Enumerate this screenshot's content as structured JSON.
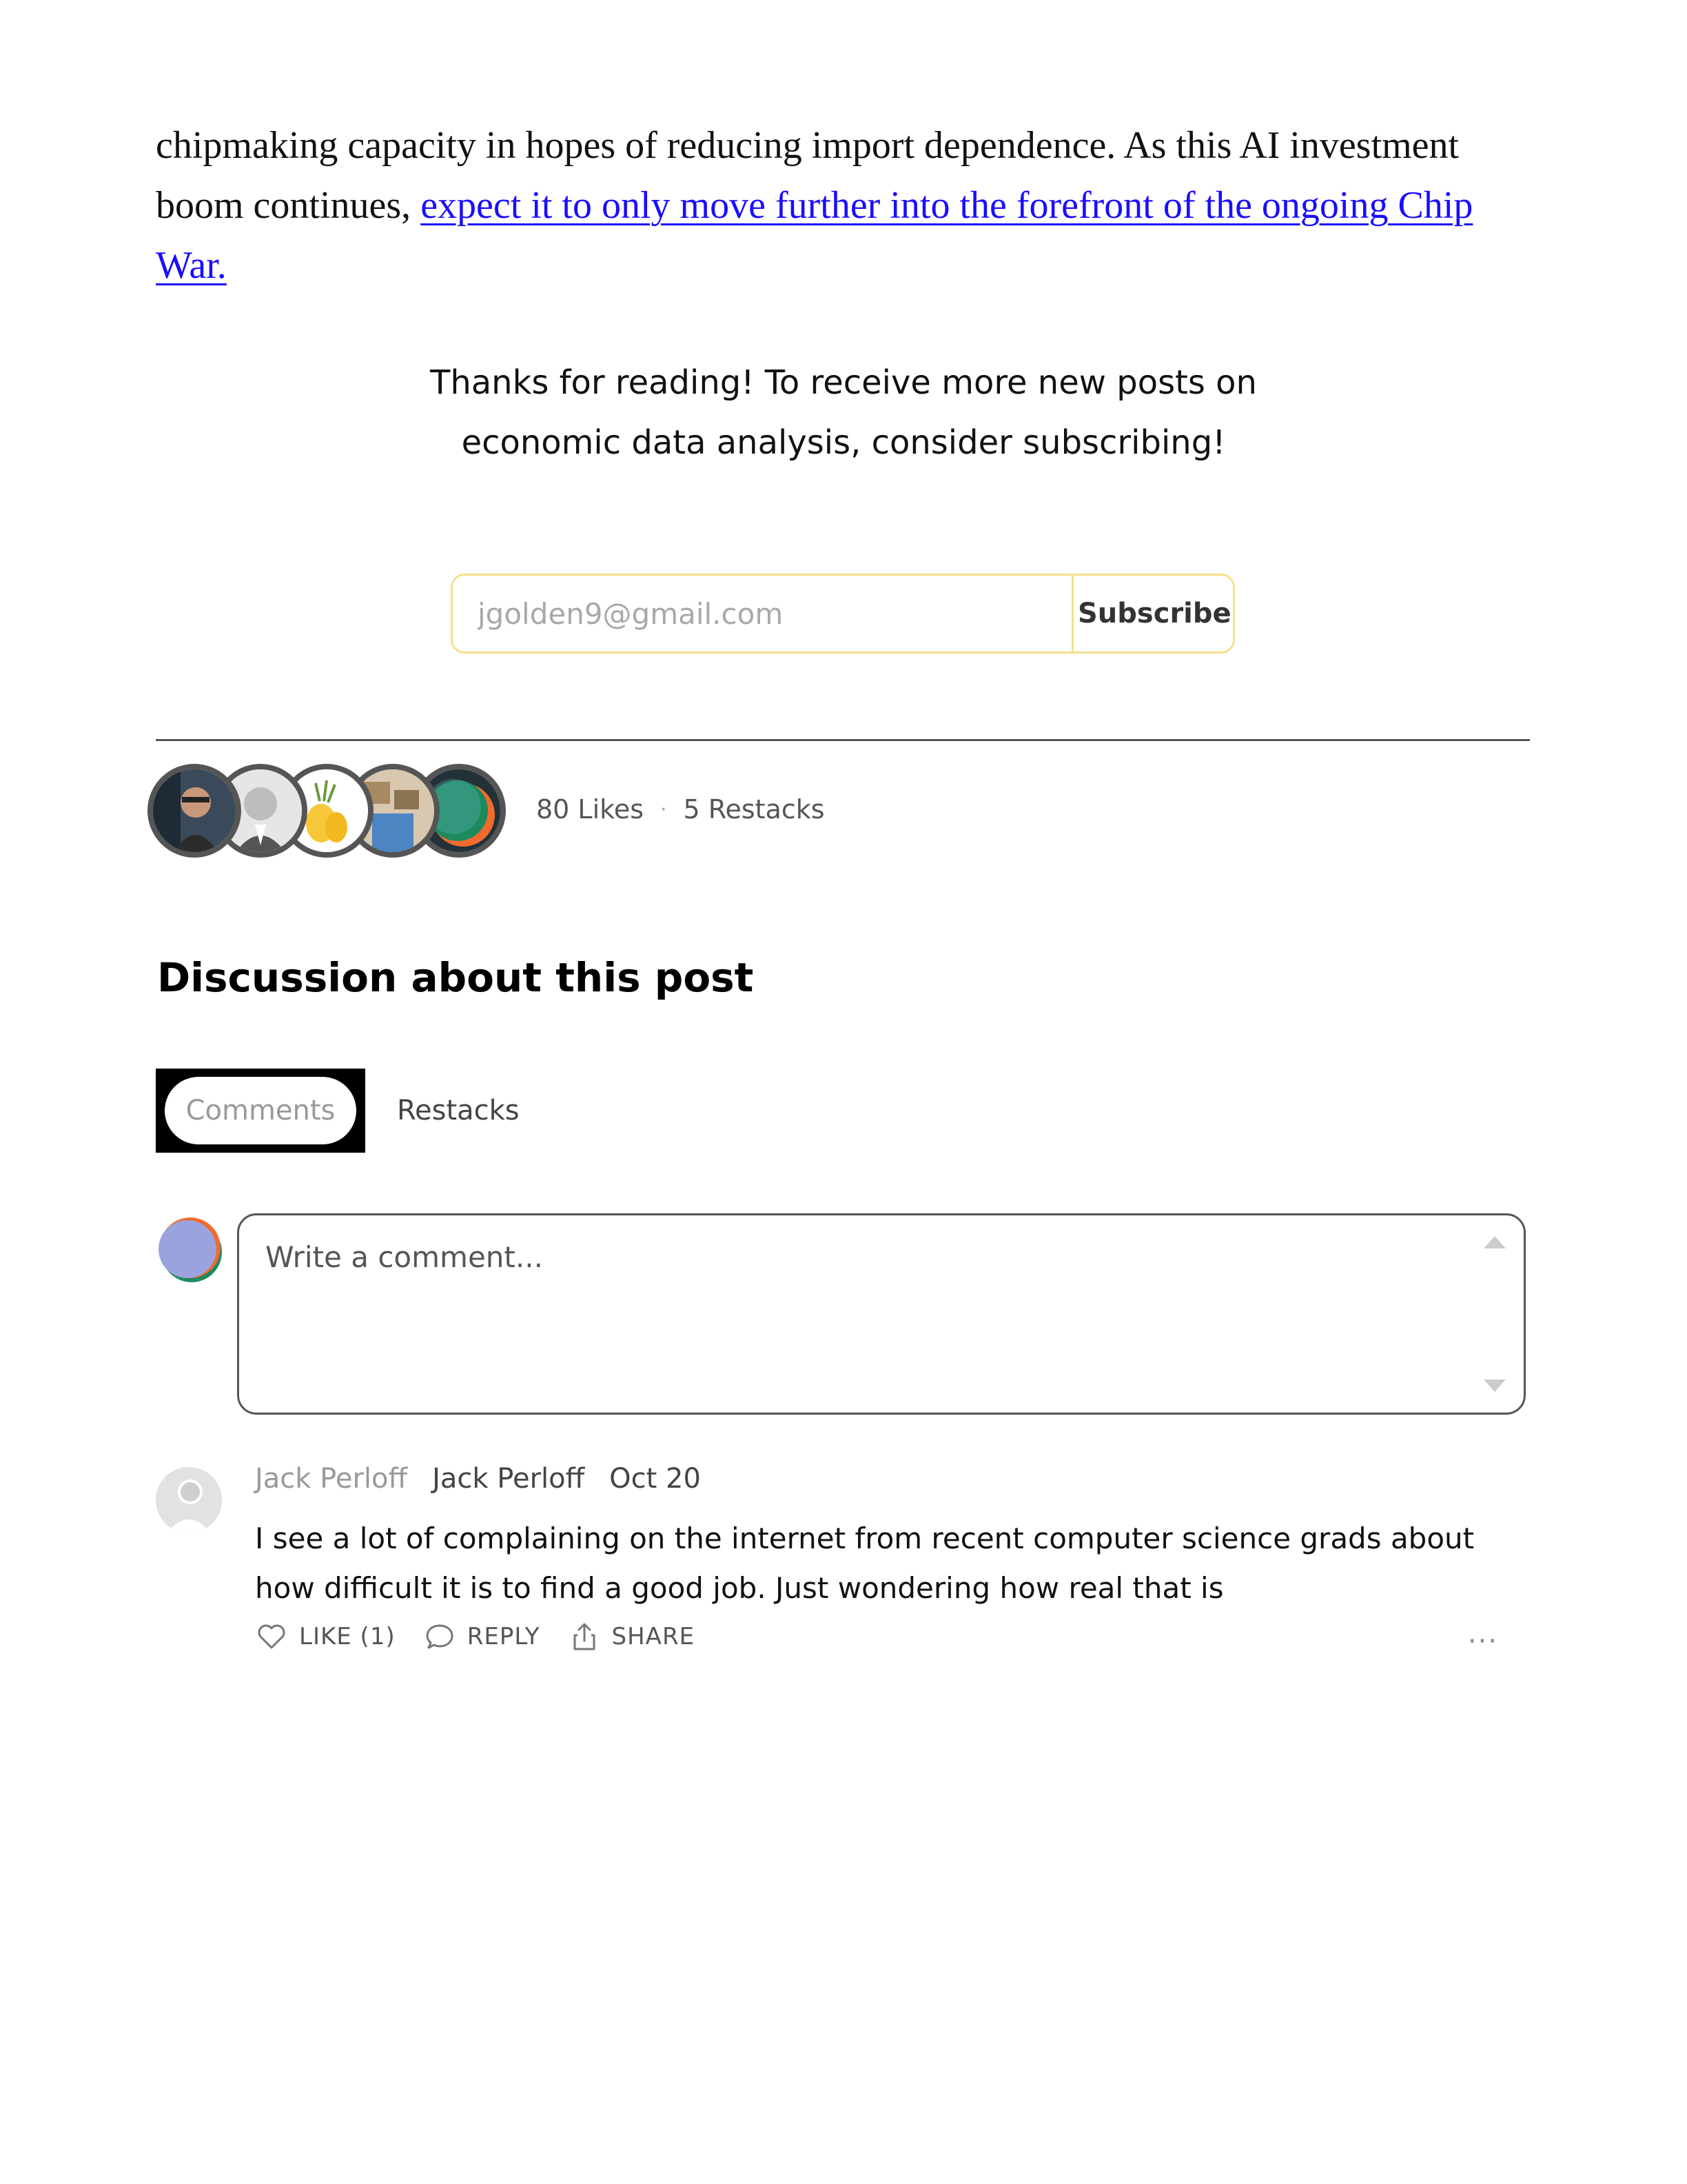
{
  "article": {
    "text_before_link": "chipmaking capacity in hopes of reducing import dependence. As this AI investment boom continues, ",
    "link_text": "expect it to only move further into the forefront of the ongoing Chip War."
  },
  "subscribe": {
    "cta_text": "Thanks for reading! To receive more new posts on economic data analysis, consider subscribing!",
    "email_value": "jgolden9@gmail.com",
    "button_label": "Subscribe"
  },
  "engagement": {
    "likes": "80 Likes",
    "separator": "·",
    "restacks": "5 Restacks"
  },
  "discussion": {
    "title": "Discussion about this post",
    "tabs": [
      {
        "label": "Comments",
        "selected": true
      },
      {
        "label": "Restacks",
        "selected": false
      }
    ],
    "comment_placeholder": "Write a comment..."
  },
  "comments": [
    {
      "handle": "Jack Perloff",
      "name": "Jack Perloff",
      "date": "Oct 20",
      "body": "I see a lot of complaining on the internet from recent computer science grads about how difficult it is to find a good job. Just wondering how real that is",
      "actions": {
        "like": "LIKE (1)",
        "reply": "REPLY",
        "share": "SHARE",
        "more": "···"
      }
    }
  ],
  "icons": {
    "like": "heart-icon",
    "reply": "speech-bubble-icon",
    "share": "share-icon",
    "more": "ellipsis-icon"
  },
  "colors": {
    "link": "#1a0dff",
    "subscribe_border": "#f5e08a",
    "avatar_ring": "#555555"
  }
}
